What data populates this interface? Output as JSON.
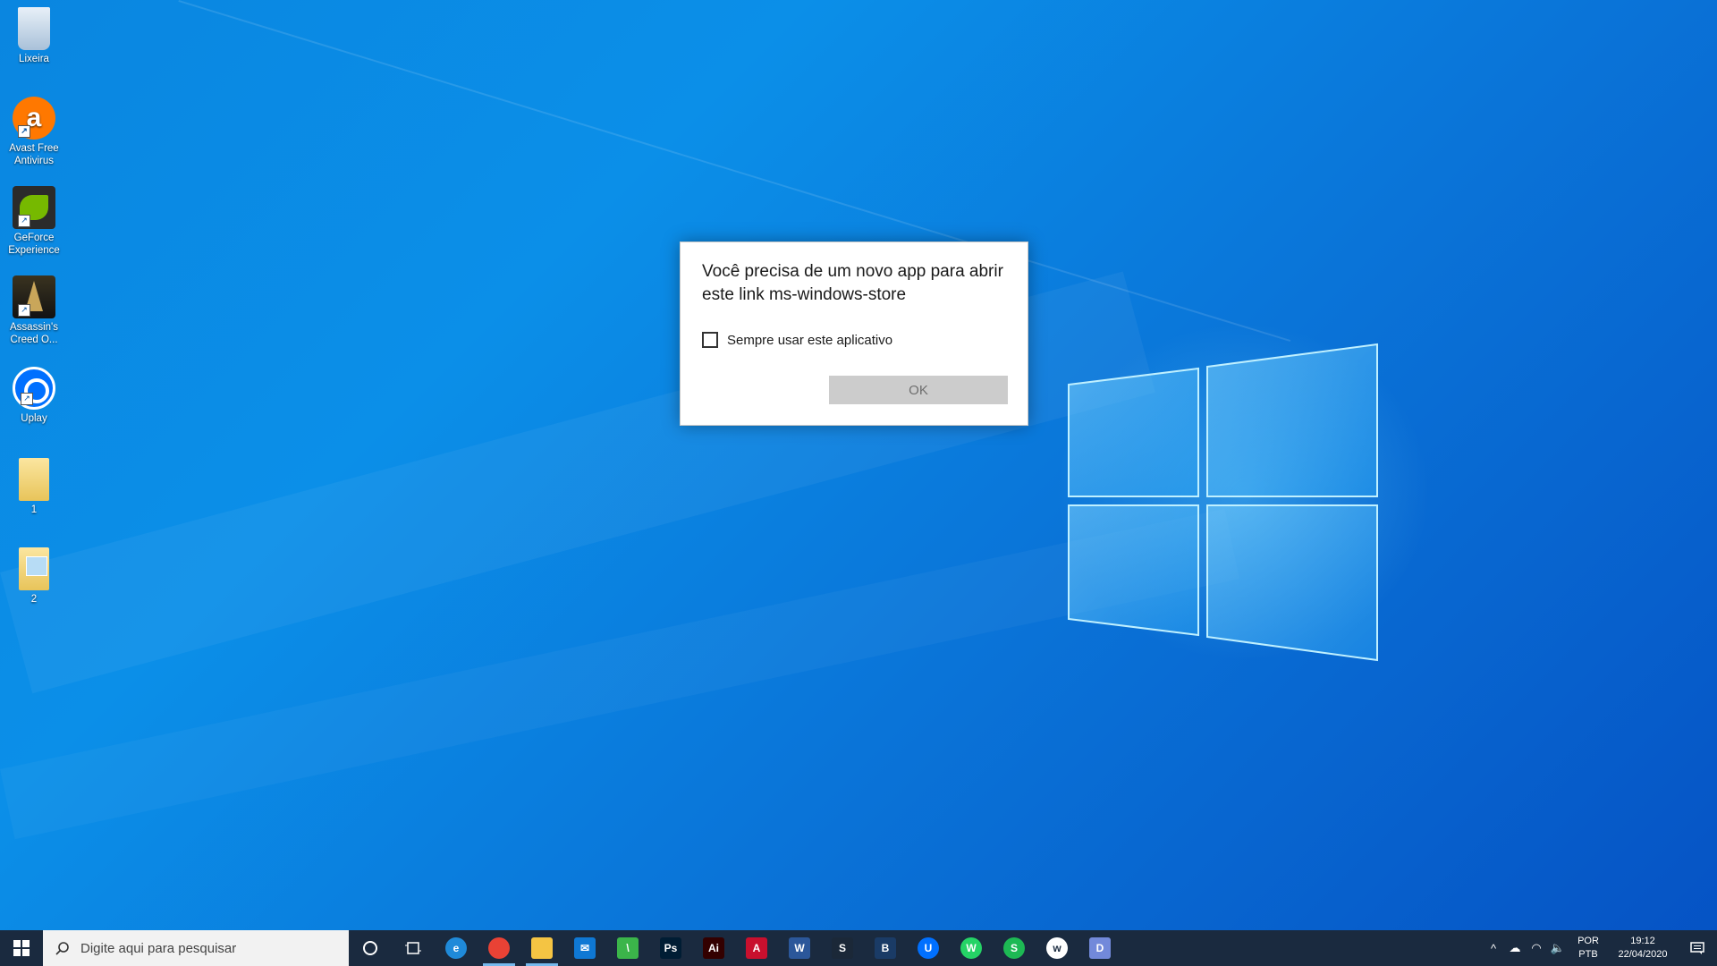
{
  "desktop": {
    "icons": [
      {
        "label": "Lixeira",
        "icon": "recycle-bin-icon"
      },
      {
        "label": "Avast Free Antivirus",
        "icon": "avast-icon"
      },
      {
        "label": "GeForce Experience",
        "icon": "geforce-icon"
      },
      {
        "label": "Assassin's Creed O...",
        "icon": "assassins-creed-icon"
      },
      {
        "label": "Uplay",
        "icon": "uplay-icon"
      },
      {
        "label": "1",
        "icon": "folder-icon"
      },
      {
        "label": "2",
        "icon": "folder-image-icon"
      }
    ]
  },
  "dialog": {
    "title": "Você precisa de um novo app para abrir este link ms-windows-store",
    "checkbox_label": "Sempre usar este aplicativo",
    "checkbox_checked": false,
    "ok_label": "OK"
  },
  "taskbar": {
    "search_placeholder": "Digite aqui para pesquisar",
    "apps": [
      {
        "name": "edge-icon",
        "glyph": "e",
        "color": "#1f8ad9",
        "active": false
      },
      {
        "name": "chrome-icon",
        "glyph": "",
        "color": "#e94235",
        "active": true
      },
      {
        "name": "file-explorer-icon",
        "glyph": "",
        "color": "#f4c443",
        "active": true
      },
      {
        "name": "mail-icon",
        "glyph": "✉",
        "color": "#0f78d4",
        "active": false
      },
      {
        "name": "green-app-icon",
        "glyph": "\\",
        "color": "#3bb54a",
        "active": false
      },
      {
        "name": "photoshop-icon",
        "glyph": "Ps",
        "color": "#001d34",
        "active": false
      },
      {
        "name": "illustrator-icon",
        "glyph": "Ai",
        "color": "#330000",
        "active": false
      },
      {
        "name": "acrobat-icon",
        "glyph": "A",
        "color": "#c8102e",
        "active": false
      },
      {
        "name": "word-icon",
        "glyph": "W",
        "color": "#2b579a",
        "active": false
      },
      {
        "name": "steam-icon",
        "glyph": "S",
        "color": "#1b2838",
        "active": false
      },
      {
        "name": "blue-app-icon",
        "glyph": "B",
        "color": "#1a3b66",
        "active": false
      },
      {
        "name": "uplay-taskbar-icon",
        "glyph": "U",
        "color": "#0070ff",
        "active": false
      },
      {
        "name": "whatsapp-icon",
        "glyph": "W",
        "color": "#25d366",
        "active": false
      },
      {
        "name": "spotify-icon",
        "glyph": "S",
        "color": "#1db954",
        "active": false
      },
      {
        "name": "white-circle-app-icon",
        "glyph": "w",
        "color": "#ffffff",
        "active": false
      },
      {
        "name": "discord-icon",
        "glyph": "D",
        "color": "#7289da",
        "active": false
      }
    ],
    "lang_top": "POR",
    "lang_bottom": "PTB",
    "time": "19:12",
    "date": "22/04/2020"
  }
}
